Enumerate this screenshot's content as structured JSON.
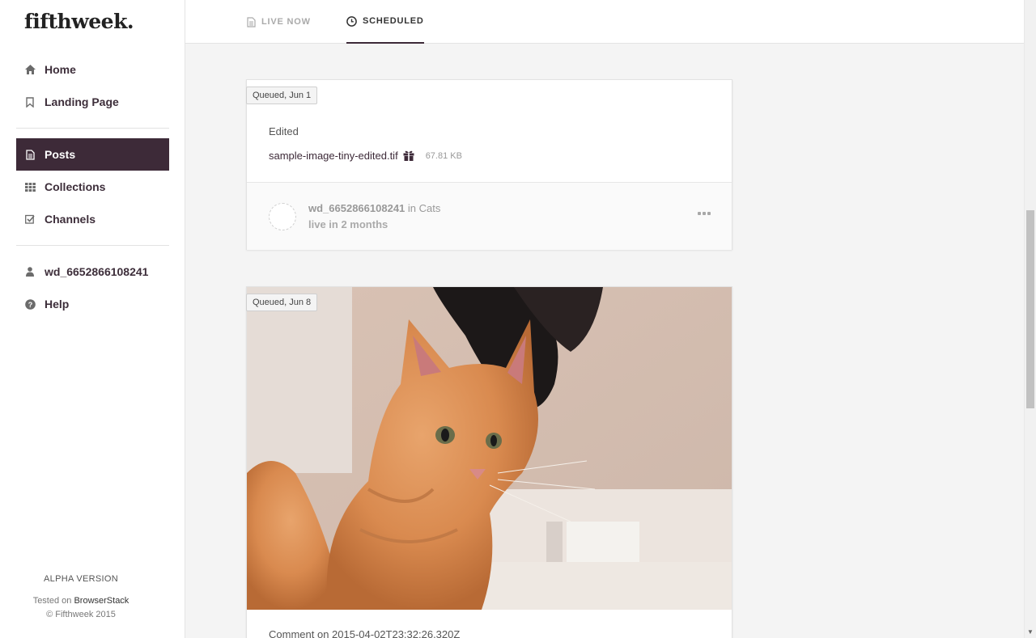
{
  "app": {
    "logo": "fifthweek."
  },
  "sidebar": {
    "items": [
      {
        "label": "Home",
        "icon": "home-icon"
      },
      {
        "label": "Landing Page",
        "icon": "bookmark-icon"
      },
      {
        "label": "Posts",
        "icon": "document-icon",
        "active": true
      },
      {
        "label": "Collections",
        "icon": "grid-icon"
      },
      {
        "label": "Channels",
        "icon": "check-square-icon"
      },
      {
        "label": "wd_6652866108241",
        "icon": "user-icon"
      },
      {
        "label": "Help",
        "icon": "question-circle-icon"
      }
    ],
    "alpha_label": "ALPHA VERSION",
    "tested_prefix": "Tested on ",
    "tested_link": "BrowserStack",
    "copyright": "© Fifthweek 2015"
  },
  "tabs": [
    {
      "label": "LIVE NOW",
      "icon": "document-icon",
      "active": false
    },
    {
      "label": "SCHEDULED",
      "icon": "clock-icon",
      "active": true
    }
  ],
  "posts": [
    {
      "badge": "Queued, Jun 1",
      "text": "Edited",
      "file_name": "sample-image-tiny-edited.tif",
      "file_size": "67.81 KB",
      "author": "wd_6652866108241",
      "in_word": " in ",
      "channel": "Cats",
      "live": "live in 2 months"
    },
    {
      "badge": "Queued, Jun 8",
      "image_alt": "kitten photo",
      "comment": "Comment on 2015-04-02T23:32:26.320Z"
    }
  ],
  "colors": {
    "accent": "#3d2a38",
    "background": "#f4f4f4"
  }
}
